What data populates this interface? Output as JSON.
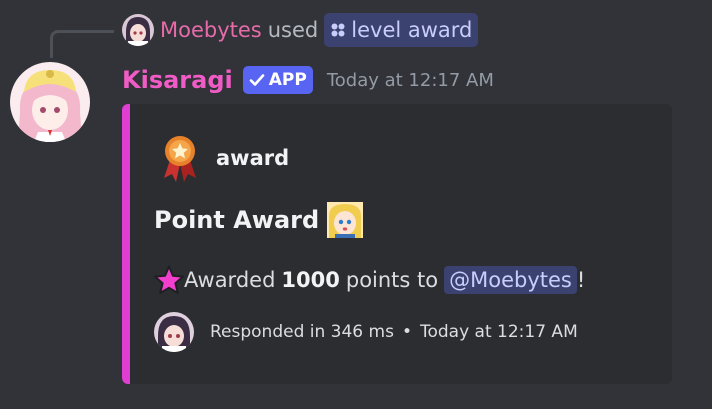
{
  "reply": {
    "user": "Moebytes",
    "used_text": "used",
    "command": "level award",
    "user_color": "#e66ba9",
    "chip_color": "#3c4270"
  },
  "message": {
    "author": "Kisaragi",
    "author_color": "#f05cc6",
    "badge_label": "APP",
    "timestamp": "Today at 12:17 AM"
  },
  "embed": {
    "accent_color": "#e03dd3",
    "author_name": "award",
    "author_icon": "medal-icon",
    "title": "Point Award",
    "title_emoji": "anime-girl-emoji",
    "description": {
      "star_icon": "pink-star-icon",
      "prefix": "Awarded",
      "amount": "1000",
      "middle": "points to",
      "mention": "@Moebytes",
      "suffix": "!"
    },
    "footer": {
      "text": "Responded in 346 ms",
      "separator": "•",
      "timestamp": "Today at 12:17 AM"
    }
  }
}
